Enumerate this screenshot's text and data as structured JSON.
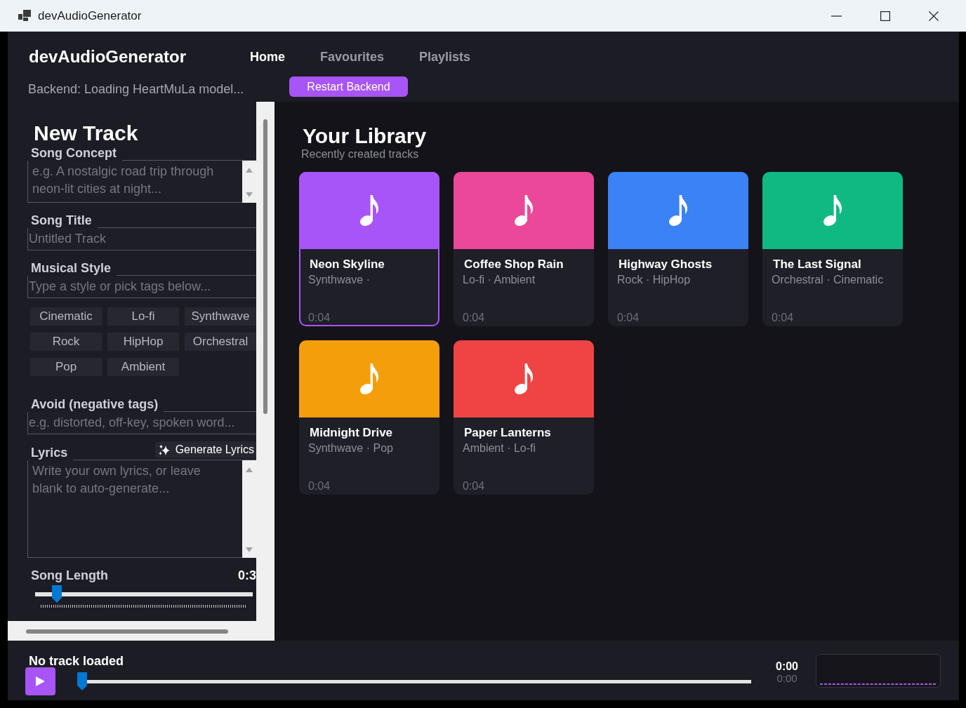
{
  "window": {
    "title": "devAudioGenerator"
  },
  "header": {
    "app_name": "devAudioGenerator",
    "nav": [
      {
        "label": "Home",
        "selected": true
      },
      {
        "label": "Favourites",
        "selected": false
      },
      {
        "label": "Playlists",
        "selected": false
      }
    ],
    "backend_status": "Backend: Loading HeartMuLa model...",
    "restart_button": "Restart Backend"
  },
  "new_track": {
    "title": "New Track",
    "fields": [
      {
        "kind": "textarea",
        "label": "Song Concept",
        "placeholder": "e.g. A nostalgic road trip through neon-lit cities at night..."
      },
      {
        "kind": "input",
        "label": "Song Title",
        "placeholder": "Untitled Track"
      },
      {
        "kind": "input",
        "label": "Musical Style",
        "placeholder": "Type a style or pick tags below...",
        "tags": [
          "Cinematic",
          "Lo-fi",
          "Synthwave",
          "Rock",
          "HipHop",
          "Orchestral",
          "Pop",
          "Ambient"
        ]
      },
      {
        "kind": "input",
        "label": "Avoid (negative tags)",
        "placeholder": "e.g. distorted, off-key, spoken word..."
      },
      {
        "kind": "textarea",
        "label": "Lyrics",
        "action": "Generate Lyrics",
        "placeholder": "Write your own lyrics, or leave blank to auto-generate..."
      },
      {
        "kind": "slider",
        "label": "Song Length",
        "reading": "0:3",
        "level": 0.08
      }
    ]
  },
  "library": {
    "title": "Your Library",
    "subtitle": "Recently created tracks",
    "tracks": [
      {
        "title": "Neon Skyline",
        "tags": "Synthwave ·",
        "duration": "0:04",
        "color": "#a855f7",
        "selected": true
      },
      {
        "title": "Coffee Shop Rain",
        "tags": "Lo-fi · Ambient",
        "duration": "0:04",
        "color": "#ec4899",
        "selected": false
      },
      {
        "title": "Highway Ghosts",
        "tags": "Rock · HipHop",
        "duration": "0:04",
        "color": "#3b82f6",
        "selected": false
      },
      {
        "title": "The Last Signal",
        "tags": "Orchestral · Cinematic",
        "duration": "0:04",
        "color": "#10b981",
        "selected": false
      },
      {
        "title": "Midnight Drive",
        "tags": "Synthwave · Pop",
        "duration": "0:04",
        "color": "#f59e0b",
        "selected": false
      },
      {
        "title": "Paper Lanterns",
        "tags": "Ambient · Lo-fi",
        "duration": "0:04",
        "color": "#ef4444",
        "selected": false
      }
    ]
  },
  "player": {
    "status": "No track loaded",
    "level": 0,
    "time": "0:00",
    "duration": "0:00"
  }
}
